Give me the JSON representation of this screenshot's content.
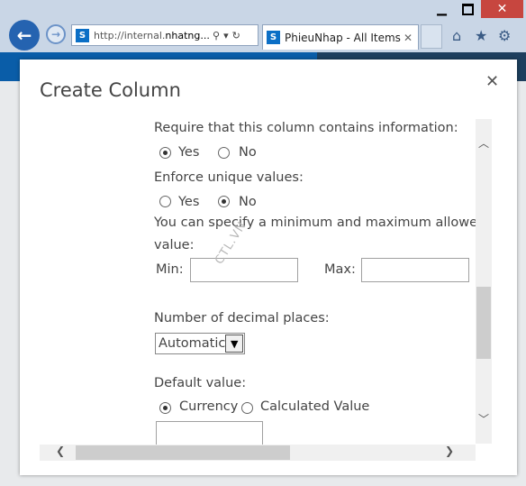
{
  "browser": {
    "url_prefix": "http://internal.",
    "url_host": "nhatng...",
    "search_symbol": "⚲",
    "dropdown_symbol": "▾",
    "refresh_symbol": "↻",
    "tab_title": "PhieuNhap - All Items",
    "tab_close": "✕",
    "site_icon_letter": "S"
  },
  "dialog": {
    "title": "Create Column",
    "close_symbol": "✕",
    "required": {
      "label": "Require that this column contains information:",
      "yes_label": "Yes",
      "no_label": "No",
      "selected": "Yes"
    },
    "unique": {
      "label": "Enforce unique values:",
      "yes_label": "Yes",
      "no_label": "No",
      "selected": "No"
    },
    "minmax": {
      "label_line1": "You can specify a minimum and maximum allowed",
      "label_line2": "value:",
      "min_label": "Min:",
      "min_value": "",
      "max_label": "Max:",
      "max_value": ""
    },
    "decimal": {
      "label": "Number of decimal places:",
      "selected": "Automatic"
    },
    "default_value": {
      "label": "Default value:",
      "currency_label": "Currency",
      "calculated_label": "Calculated Value",
      "selected": "Currency",
      "value": ""
    }
  },
  "watermark": "CTL.VN",
  "colors": {
    "accent": "#0a5da8",
    "close": "#c7463f"
  }
}
